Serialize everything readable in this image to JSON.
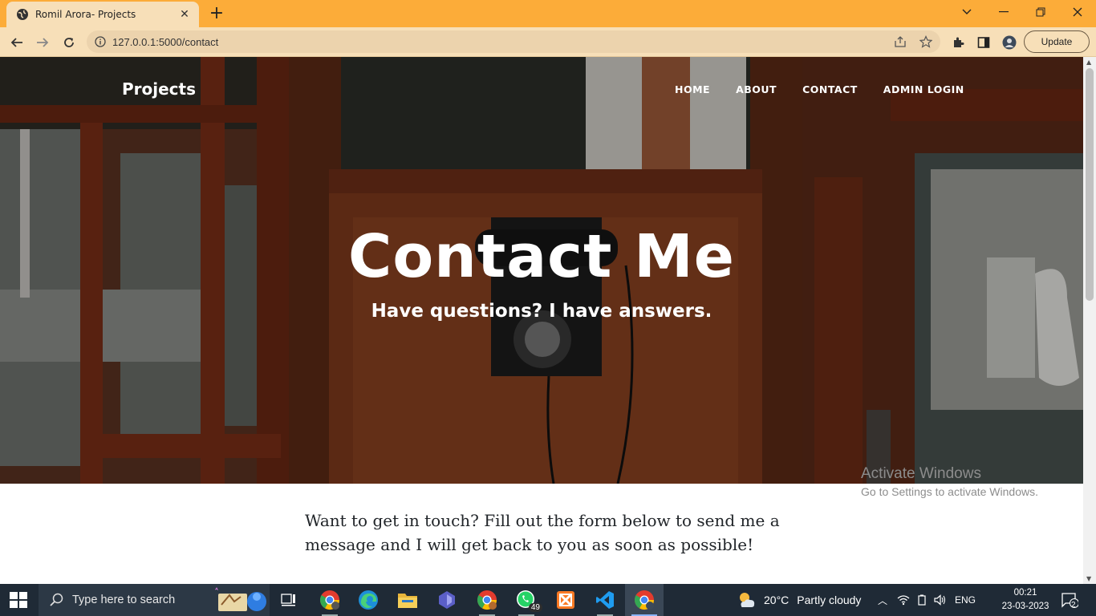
{
  "browser": {
    "tab_title": "Romil Arora- Projects",
    "url": "127.0.0.1:5000/contact",
    "update_label": "Update"
  },
  "site": {
    "brand": "Projects",
    "nav": [
      "HOME",
      "ABOUT",
      "CONTACT",
      "ADMIN LOGIN"
    ],
    "hero_title": "Contact Me",
    "hero_subtitle": "Have questions? I have answers.",
    "intro": "Want to get in touch? Fill out the form below to send me a message and I will get back to you as soon as possible!"
  },
  "watermark": {
    "line1": "Activate Windows",
    "line2": "Go to Settings to activate Windows."
  },
  "taskbar": {
    "search_placeholder": "Type here to search",
    "whatsapp_badge": "49",
    "weather_temp": "20°C",
    "weather_desc": "Partly cloudy",
    "language": "ENG",
    "time": "00:21",
    "date": "23-03-2023",
    "notification_count": "2"
  },
  "colors": {
    "tabstrip": "#fcac39",
    "toolbar": "#f7dfb8",
    "taskbar": "#1f2a36"
  }
}
